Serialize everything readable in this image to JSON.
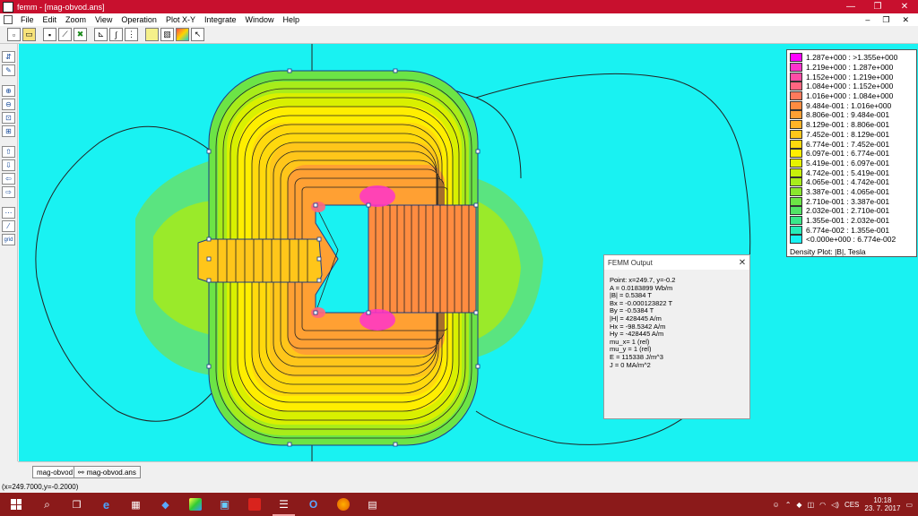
{
  "window": {
    "title": "femm - [mag-obvod.ans]",
    "minimize": "—",
    "maximize": "❐",
    "close": "✕"
  },
  "menu": [
    "File",
    "Edit",
    "Zoom",
    "View",
    "Operation",
    "Plot X-Y",
    "Integrate",
    "Window",
    "Help"
  ],
  "mdi_buttons": [
    "–",
    "❐",
    "✕"
  ],
  "toolbar": [
    "new-file-icon",
    "open-file-icon",
    "select-node-icon",
    "line-icon",
    "mesh-icon",
    "contour-icon",
    "integrate-icon",
    "plot-icon",
    "density-plot-icon",
    "vector-plot-icon",
    "zoom-window-icon",
    "pointer-icon"
  ],
  "legend": {
    "rows": [
      {
        "label": "1.287e+000 : >1.355e+000",
        "color": "#ff00ff"
      },
      {
        "label": "1.219e+000 : 1.287e+000",
        "color": "#ff33cc"
      },
      {
        "label": "1.152e+000 : 1.219e+000",
        "color": "#ff4da6"
      },
      {
        "label": "1.084e+000 : 1.152e+000",
        "color": "#ff6680"
      },
      {
        "label": "1.016e+000 : 1.084e+000",
        "color": "#ff7a5c"
      },
      {
        "label": "9.484e-001 : 1.016e+000",
        "color": "#ff8c40"
      },
      {
        "label": "8.806e-001 : 9.484e-001",
        "color": "#ffa033"
      },
      {
        "label": "8.129e-001 : 8.806e-001",
        "color": "#ffb326"
      },
      {
        "label": "7.452e-001 : 8.129e-001",
        "color": "#ffc61a"
      },
      {
        "label": "6.774e-001 : 7.452e-001",
        "color": "#ffd90d"
      },
      {
        "label": "6.097e-001 : 6.774e-001",
        "color": "#ffee00"
      },
      {
        "label": "5.419e-001 : 6.097e-001",
        "color": "#e6f200"
      },
      {
        "label": "4.742e-001 : 5.419e-001",
        "color": "#c8f00a"
      },
      {
        "label": "4.065e-001 : 4.742e-001",
        "color": "#a8ec1a"
      },
      {
        "label": "3.387e-001 : 4.065e-001",
        "color": "#8ae62e"
      },
      {
        "label": "2.710e-001 : 3.387e-001",
        "color": "#6ce446"
      },
      {
        "label": "2.032e-001 : 2.710e-001",
        "color": "#52e466"
      },
      {
        "label": "1.355e-001 : 2.032e-001",
        "color": "#3ae88a"
      },
      {
        "label": "6.774e-002 : 1.355e-001",
        "color": "#26ecb8"
      },
      {
        "label": "<0.000e+000 : 6.774e-002",
        "color": "#19f2f2"
      }
    ],
    "caption": "Density Plot: |B|, Tesla"
  },
  "output": {
    "title": "FEMM Output",
    "lines": [
      "Point: x=249.7, y=-0.2",
      "A  = 0.0183899 Wb/m",
      "|B| = 0.5384 T",
      "Bx  = -0.000123822 T",
      "By  = -0.5384 T",
      "|H| = 428445 A/m",
      "Hx  = -98.5342 A/m",
      "Hy  = -428445 A/m",
      "mu_x= 1 (rel)",
      "mu_y = 1 (rel)",
      "E  = 115338 J/m^3",
      "J  = 0 MA/m^2"
    ]
  },
  "tabs": [
    "mag-obvod",
    "mag-obvod.ans"
  ],
  "status": "(x=249.7000,y=-0.2000)",
  "tray": {
    "language": "CES",
    "time": "10:18",
    "date": "23. 7. 2017"
  }
}
